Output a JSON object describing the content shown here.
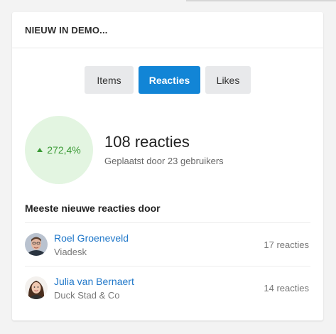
{
  "widget": {
    "title": "NIEUW IN DEMO..."
  },
  "tabs": [
    {
      "label": "Items",
      "active": false
    },
    {
      "label": "Reacties",
      "active": true
    },
    {
      "label": "Likes",
      "active": false
    }
  ],
  "stat": {
    "trend": "up",
    "percent": "272,4%",
    "main": "108 reacties",
    "sub": "Geplaatst door 23 gebruikers"
  },
  "section": {
    "title": "Meeste nieuwe reacties door"
  },
  "people": [
    {
      "name": "Roel Groeneveld",
      "org": "Viadesk",
      "count": "17 reacties"
    },
    {
      "name": "Julia van Bernaert",
      "org": "Duck Stad & Co",
      "count": "14 reacties"
    }
  ],
  "colors": {
    "accent": "#1285d6",
    "positive": "#3a9a35",
    "positive_bg": "#e3f5e1",
    "link": "#1f77c9"
  }
}
